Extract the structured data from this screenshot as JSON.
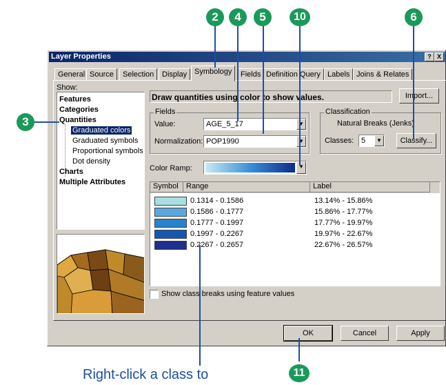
{
  "window": {
    "title": "Layer Properties",
    "help_btn": "?",
    "close_btn": "X"
  },
  "tabs": [
    {
      "label": "General"
    },
    {
      "label": "Source"
    },
    {
      "label": "Selection"
    },
    {
      "label": "Display"
    },
    {
      "label": "Symbology",
      "active": true
    },
    {
      "label": "Fields"
    },
    {
      "label": "Definition Query"
    },
    {
      "label": "Labels"
    },
    {
      "label": "Joins & Relates"
    }
  ],
  "show": {
    "label": "Show:",
    "items": [
      {
        "label": "Features"
      },
      {
        "label": "Categories"
      },
      {
        "label": "Quantities"
      },
      {
        "label": "Graduated colors",
        "selected": true
      },
      {
        "label": "Graduated symbols"
      },
      {
        "label": "Proportional symbols"
      },
      {
        "label": "Dot density"
      },
      {
        "label": "Charts"
      },
      {
        "label": "Multiple Attributes"
      }
    ]
  },
  "header_text": "Draw quantities using color to show values.",
  "import_btn": "Import...",
  "fields": {
    "legend": "Fields",
    "value_label": "Value:",
    "value": "AGE_5_17",
    "normalization_label": "Normalization:",
    "normalization": "POP1990"
  },
  "classification": {
    "legend": "Classification",
    "method": "Natural Breaks (Jenks)",
    "classes_label": "Classes:",
    "classes": "5",
    "classify_btn": "Classify..."
  },
  "color_ramp_label": "Color Ramp:",
  "table": {
    "headers": {
      "symbol": "Symbol",
      "range": "Range",
      "label": "Label"
    },
    "rows": [
      {
        "color": "#a8dfe0",
        "range": "0.1314 - 0.1586",
        "label": "13.14% - 15.86%"
      },
      {
        "color": "#59a9e0",
        "range": "0.1586 - 0.1777",
        "label": "15.86% - 17.77%"
      },
      {
        "color": "#2a82cc",
        "range": "0.1777 - 0.1997",
        "label": "17.77% - 19.97%"
      },
      {
        "color": "#1458b4",
        "range": "0.1997 - 0.2267",
        "label": "19.97% - 22.67%"
      },
      {
        "color": "#1e2f8e",
        "range": "0.2267 - 0.2657",
        "label": "22.67% - 26.57%"
      }
    ]
  },
  "show_breaks_label": "Show class breaks using feature values",
  "buttons": {
    "ok": "OK",
    "cancel": "Cancel",
    "apply": "Apply"
  },
  "callouts": [
    "2",
    "4",
    "5",
    "10",
    "6",
    "3",
    "11"
  ],
  "caption": "Right-click a class to",
  "colors": {
    "callout": "#1a9a5a",
    "caption": "#1a4fa8",
    "dialog": "#d4d0c8",
    "title": "#0a246a"
  }
}
